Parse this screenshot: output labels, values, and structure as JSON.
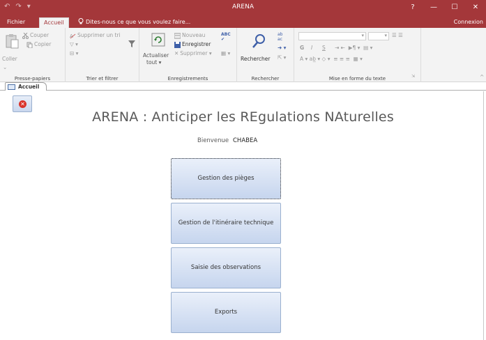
{
  "window": {
    "title": "ARENA",
    "help_label": "?",
    "minimize_label": "—",
    "maximize_label": "☐",
    "close_label": "✕"
  },
  "quick_access": {
    "undo_icon": "↶",
    "redo_icon": "↷",
    "customize_icon": "▾"
  },
  "ribbon_tabs": {
    "file": "Fichier",
    "home": "Accueil",
    "tell_me": "Dites-nous ce que vous voulez faire...",
    "account": "Connexion"
  },
  "ribbon": {
    "clipboard": {
      "paste": "Coller",
      "cut": "Couper",
      "copy": "Copier",
      "label": "Presse-papiers"
    },
    "sort_filter": {
      "remove_sort": "Supprimer un tri",
      "label": "Trier et filtrer"
    },
    "records": {
      "refresh_line1": "Actualiser",
      "refresh_line2": "tout",
      "new": "Nouveau",
      "save": "Enregistrer",
      "delete": "Supprimer",
      "label": "Enregistrements"
    },
    "find": {
      "find": "Rechercher",
      "label": "Rechercher"
    },
    "text_format": {
      "bold": "G",
      "italic": "I",
      "underline": "S",
      "label": "Mise en forme du texte"
    }
  },
  "object_tab": {
    "label": "Accueil"
  },
  "form": {
    "title": "ARENA : Anticiper les REgulations NAturelles",
    "welcome_label": "Bienvenue",
    "username": "CHABEA",
    "buttons": [
      {
        "label": "Gestion des pièges"
      },
      {
        "label": "Gestion de l'itinéraire technique"
      },
      {
        "label": "Saisie des observations"
      },
      {
        "label": "Exports"
      }
    ]
  },
  "colors": {
    "accent": "#a4373a",
    "ribbon_bg": "#f3f3f3",
    "button_top": "#eaf0fa",
    "button_bottom": "#c6d5ee",
    "close_red": "#d9342b"
  }
}
